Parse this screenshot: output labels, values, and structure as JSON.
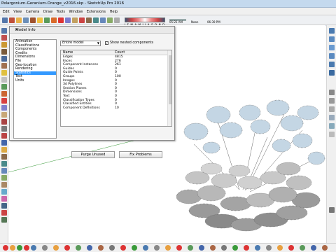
{
  "window": {
    "title": "Pelargonium-Geranium-Orange_v2016.skp - SketchUp Pro 2016"
  },
  "menu": [
    "Edit",
    "View",
    "Camera",
    "Draw",
    "Tools",
    "Window",
    "Extensions",
    "Help"
  ],
  "shadow": {
    "months": "J F M A M J J A S O N D",
    "time_start": "05:21 AM",
    "noon": "Noon",
    "time_end": "06:39 PM"
  },
  "dialog": {
    "title": "Model Info",
    "close": "x",
    "sections": [
      "Animation",
      "Classifications",
      "Components",
      "Credits",
      "Dimensions",
      "File",
      "Geo-location",
      "Rendering",
      "Statistics",
      "Text",
      "Units"
    ],
    "selected_section": "Statistics",
    "scope": "Entire model",
    "show_nested_label": "Show nested components",
    "show_nested_checked": true,
    "columns": [
      "Name",
      "Count"
    ],
    "rows": [
      [
        "Edges",
        "4815"
      ],
      [
        "Faces",
        "276"
      ],
      [
        "Component Instances",
        "261"
      ],
      [
        "Guides",
        "0"
      ],
      [
        "Guide Points",
        "0"
      ],
      [
        "Groups",
        "100"
      ],
      [
        "Images",
        "0"
      ],
      [
        "3d Polylines",
        "0"
      ],
      [
        "Section Planes",
        "0"
      ],
      [
        "Dimensions",
        "0"
      ],
      [
        "Text",
        "0"
      ],
      [
        "Classification Types",
        "0"
      ],
      [
        "Classified Entities",
        "0"
      ],
      [
        "Component Definitions",
        "10"
      ]
    ],
    "purge_label": "Purge Unused",
    "fix_label": "Fix Problems"
  },
  "colors": {
    "leaf_top": "#c4d6e4",
    "leaf_mid": "#b4b4b4",
    "leaf_dark": "#8e8e8e",
    "axis_green": "#3a9a3a",
    "axis_blue": "#4466cc",
    "selection": "#3399ff"
  }
}
